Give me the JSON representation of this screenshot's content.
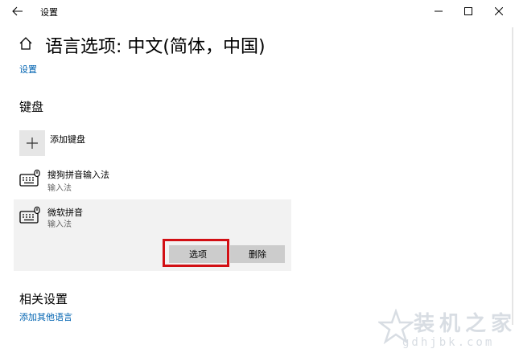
{
  "window": {
    "title": "设置"
  },
  "header": {
    "title": "语言选项: 中文(简体，中国)",
    "breadcrumb_link": "设置"
  },
  "keyboard_section": {
    "title": "键盘",
    "add_label": "添加键盘",
    "items": [
      {
        "name": "搜狗拼音输入法",
        "type": "输入法"
      },
      {
        "name": "微软拼音",
        "type": "输入法",
        "options_label": "选项",
        "delete_label": "删除"
      }
    ]
  },
  "related_section": {
    "title": "相关设置",
    "link": "添加其他语言"
  },
  "watermark": {
    "text": "装机之家",
    "url": "gdhjbk.com"
  },
  "colors": {
    "accent": "#0063b1",
    "highlight": "#d20f14"
  }
}
